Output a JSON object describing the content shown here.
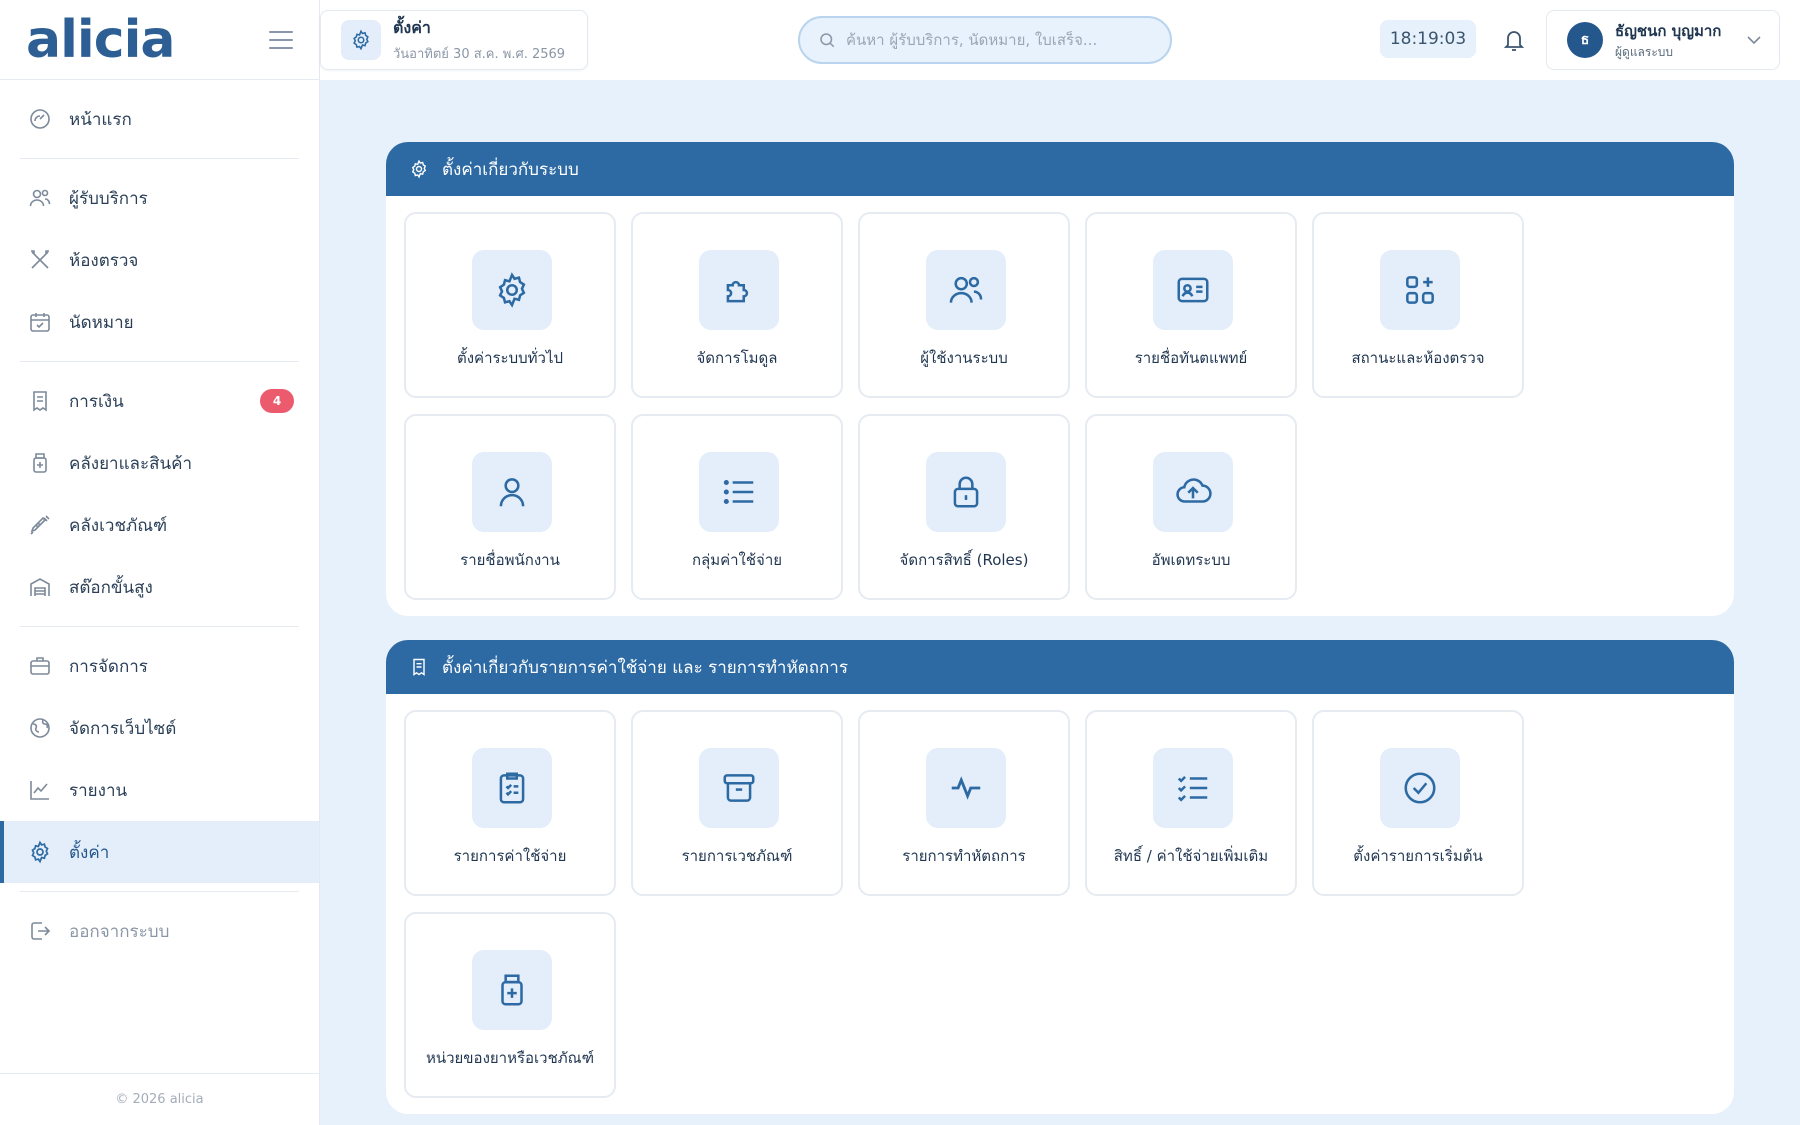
{
  "brand": {
    "logo": "alicia",
    "accent": "#2d6aa3",
    "bg": "#e6f1fb"
  },
  "sidebar": {
    "items": [
      {
        "label": "หน้าแรก",
        "icon": "dashboard-gauge-icon"
      },
      {
        "label": "ผู้รับบริการ",
        "icon": "users-icon"
      },
      {
        "label": "ห้องตรวจ",
        "icon": "dental-tools-icon"
      },
      {
        "label": "นัดหมาย",
        "icon": "calendar-icon"
      },
      {
        "label": "การเงิน",
        "icon": "receipt-icon",
        "badge": "4"
      },
      {
        "label": "คลังยาและสินค้า",
        "icon": "medicine-bottle-icon"
      },
      {
        "label": "คลังเวชภัณฑ์",
        "icon": "syringe-icon"
      },
      {
        "label": "สต๊อกขั้นสูง",
        "icon": "warehouse-icon"
      },
      {
        "label": "การจัดการ",
        "icon": "briefcase-icon"
      },
      {
        "label": "จัดการเว็บไซต์",
        "icon": "globe-icon"
      },
      {
        "label": "รายงาน",
        "icon": "chart-line-icon"
      },
      {
        "label": "ตั้งค่า",
        "icon": "gear-icon",
        "active": true
      },
      {
        "label": "ออกจากระบบ",
        "icon": "logout-icon"
      }
    ],
    "footer": "© 2026 alicia"
  },
  "topbar": {
    "page_title": "ตั้งค่า",
    "page_date": "วันอาทิตย์ 30 ส.ค. พ.ศ. 2569",
    "search_placeholder": "ค้นหา ผู้รับบริการ, นัดหมาย, ใบเสร็จ...",
    "clock": "18:19:03",
    "user_initial": "ธ",
    "user_name": "ธัญชนก บุญมาก",
    "user_role": "ผู้ดูแลระบบ"
  },
  "panels": [
    {
      "title": "ตั้งค่าเกี่ยวกับระบบ",
      "icon": "gear-icon",
      "tiles": [
        {
          "label": "ตั้งค่าระบบทั่วไป",
          "icon": "gear-icon"
        },
        {
          "label": "จัดการโมดูล",
          "icon": "puzzle-icon"
        },
        {
          "label": "ผู้ใช้งานระบบ",
          "icon": "users-icon"
        },
        {
          "label": "รายชื่อทันตแพทย์",
          "icon": "id-card-icon"
        },
        {
          "label": "สถานะและห้องตรวจ",
          "icon": "grid-plus-icon"
        },
        {
          "label": "รายชื่อพนักงาน",
          "icon": "user-icon"
        },
        {
          "label": "กลุ่มค่าใช้จ่าย",
          "icon": "list-icon"
        },
        {
          "label": "จัดการสิทธิ์ (Roles)",
          "icon": "lock-icon"
        },
        {
          "label": "อัพเดทระบบ",
          "icon": "cloud-upload-icon"
        }
      ]
    },
    {
      "title": "ตั้งค่าเกี่ยวกับรายการค่าใช้จ่าย และ รายการทำหัตถการ",
      "icon": "receipt-icon",
      "tiles": [
        {
          "label": "รายการค่าใช้จ่าย",
          "icon": "clipboard-list-icon"
        },
        {
          "label": "รายการเวชภัณฑ์",
          "icon": "archive-box-icon"
        },
        {
          "label": "รายการทำหัตถการ",
          "icon": "pulse-icon"
        },
        {
          "label": "สิทธิ์ / ค่าใช้จ่ายเพิ่มเติม",
          "icon": "checklist-icon"
        },
        {
          "label": "ตั้งค่ารายการเริ่มต้น",
          "icon": "check-circle-icon"
        },
        {
          "label": "หน่วยของยาหรือเวชภัณฑ์",
          "icon": "medicine-bottle-icon"
        }
      ]
    }
  ]
}
